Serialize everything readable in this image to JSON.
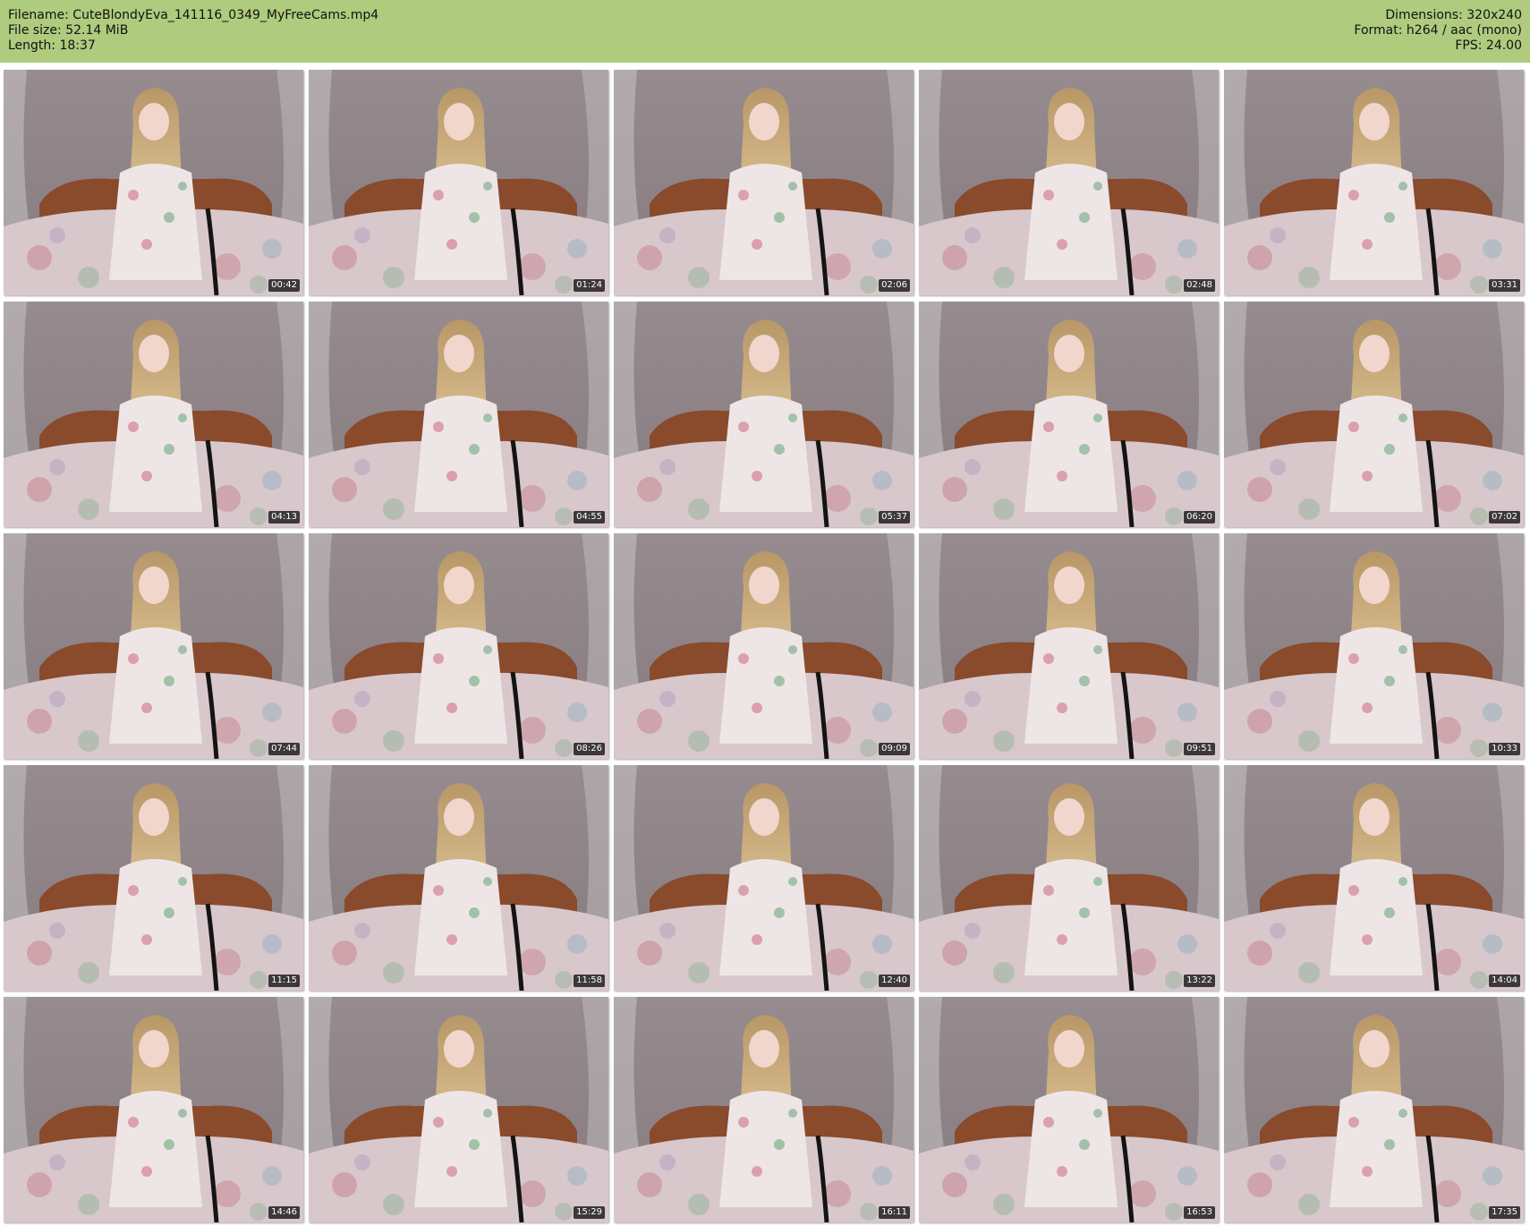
{
  "header": {
    "filename": "Filename: CuteBlondyEva_141116_0349_MyFreeCams.mp4",
    "filesize": "File size: 52.14 MiB",
    "length": "Length: 18:37",
    "dimensions": "Dimensions: 320x240",
    "format": "Format: h264 / aac (mono)",
    "fps": "FPS: 24.00",
    "background": "#aecb7e"
  },
  "thumbnails": [
    {
      "timestamp": "00:42"
    },
    {
      "timestamp": "01:24"
    },
    {
      "timestamp": "02:06"
    },
    {
      "timestamp": "02:48"
    },
    {
      "timestamp": "03:31"
    },
    {
      "timestamp": "04:13"
    },
    {
      "timestamp": "04:55"
    },
    {
      "timestamp": "05:37"
    },
    {
      "timestamp": "06:20"
    },
    {
      "timestamp": "07:02"
    },
    {
      "timestamp": "07:44"
    },
    {
      "timestamp": "08:26"
    },
    {
      "timestamp": "09:09"
    },
    {
      "timestamp": "09:51"
    },
    {
      "timestamp": "10:33"
    },
    {
      "timestamp": "11:15"
    },
    {
      "timestamp": "11:58"
    },
    {
      "timestamp": "12:40"
    },
    {
      "timestamp": "13:22"
    },
    {
      "timestamp": "14:04"
    },
    {
      "timestamp": "14:46"
    },
    {
      "timestamp": "15:29"
    },
    {
      "timestamp": "16:11"
    },
    {
      "timestamp": "16:53"
    },
    {
      "timestamp": "17:35"
    }
  ]
}
